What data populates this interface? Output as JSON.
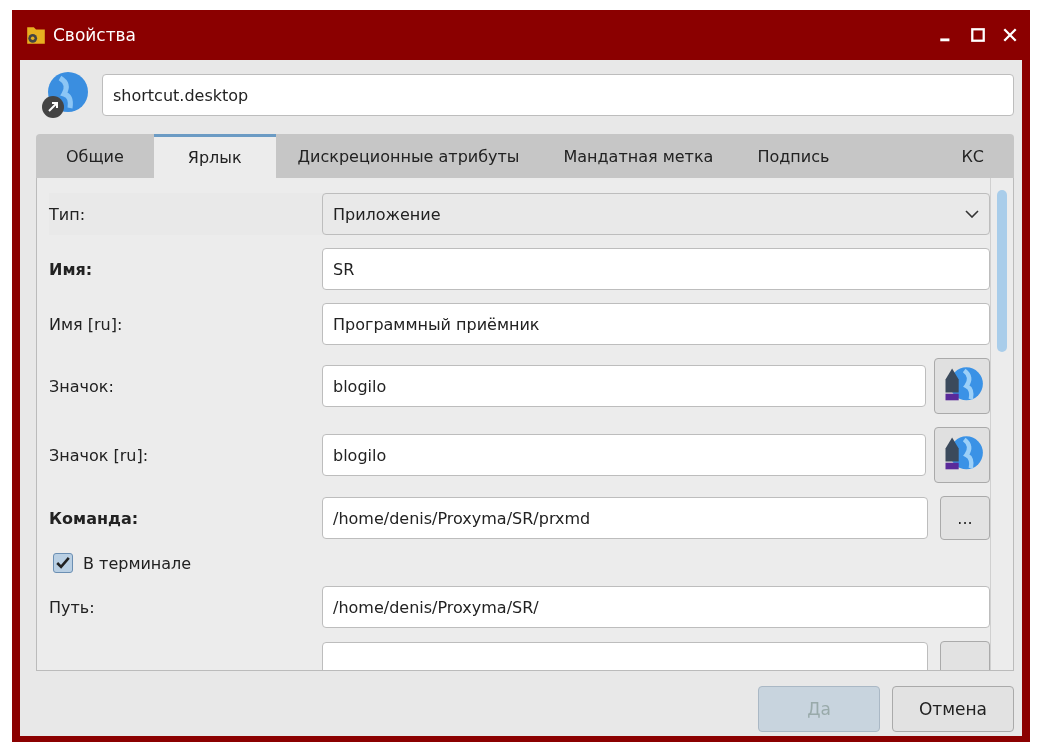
{
  "window": {
    "title": "Свойства"
  },
  "file_name": "shortcut.desktop",
  "tabs": [
    {
      "label": "Общие",
      "selected": false
    },
    {
      "label": "Ярлык",
      "selected": true
    },
    {
      "label": "Дискреционные атрибуты",
      "selected": false
    },
    {
      "label": "Мандатная метка",
      "selected": false
    },
    {
      "label": "Подпись",
      "selected": false
    },
    {
      "label": "КС",
      "selected": false
    }
  ],
  "fields": [
    {
      "kind": "select",
      "label": "Тип:",
      "bold": false,
      "value": "Приложение"
    },
    {
      "kind": "text",
      "label": "Имя:",
      "bold": true,
      "value": "SR"
    },
    {
      "kind": "text",
      "label": "Имя [ru]:",
      "bold": false,
      "value": "Программный приёмник"
    },
    {
      "kind": "icon",
      "label": "Значок:",
      "bold": false,
      "value": "blogilo"
    },
    {
      "kind": "icon",
      "label": "Значок [ru]:",
      "bold": false,
      "value": "blogilo"
    },
    {
      "kind": "browse",
      "label": "Команда:",
      "bold": true,
      "value": "/home/denis/Proxyma/SR/prxmd",
      "button": "..."
    },
    {
      "kind": "checkbox",
      "label": "В терминале",
      "checked": true
    },
    {
      "kind": "text",
      "label": "Путь:",
      "bold": false,
      "value": "/home/denis/Proxyma/SR/"
    },
    {
      "kind": "browse"
    }
  ],
  "buttons": [
    {
      "label": "Да",
      "disabled": true
    },
    {
      "label": "Отмена",
      "disabled": false
    }
  ]
}
